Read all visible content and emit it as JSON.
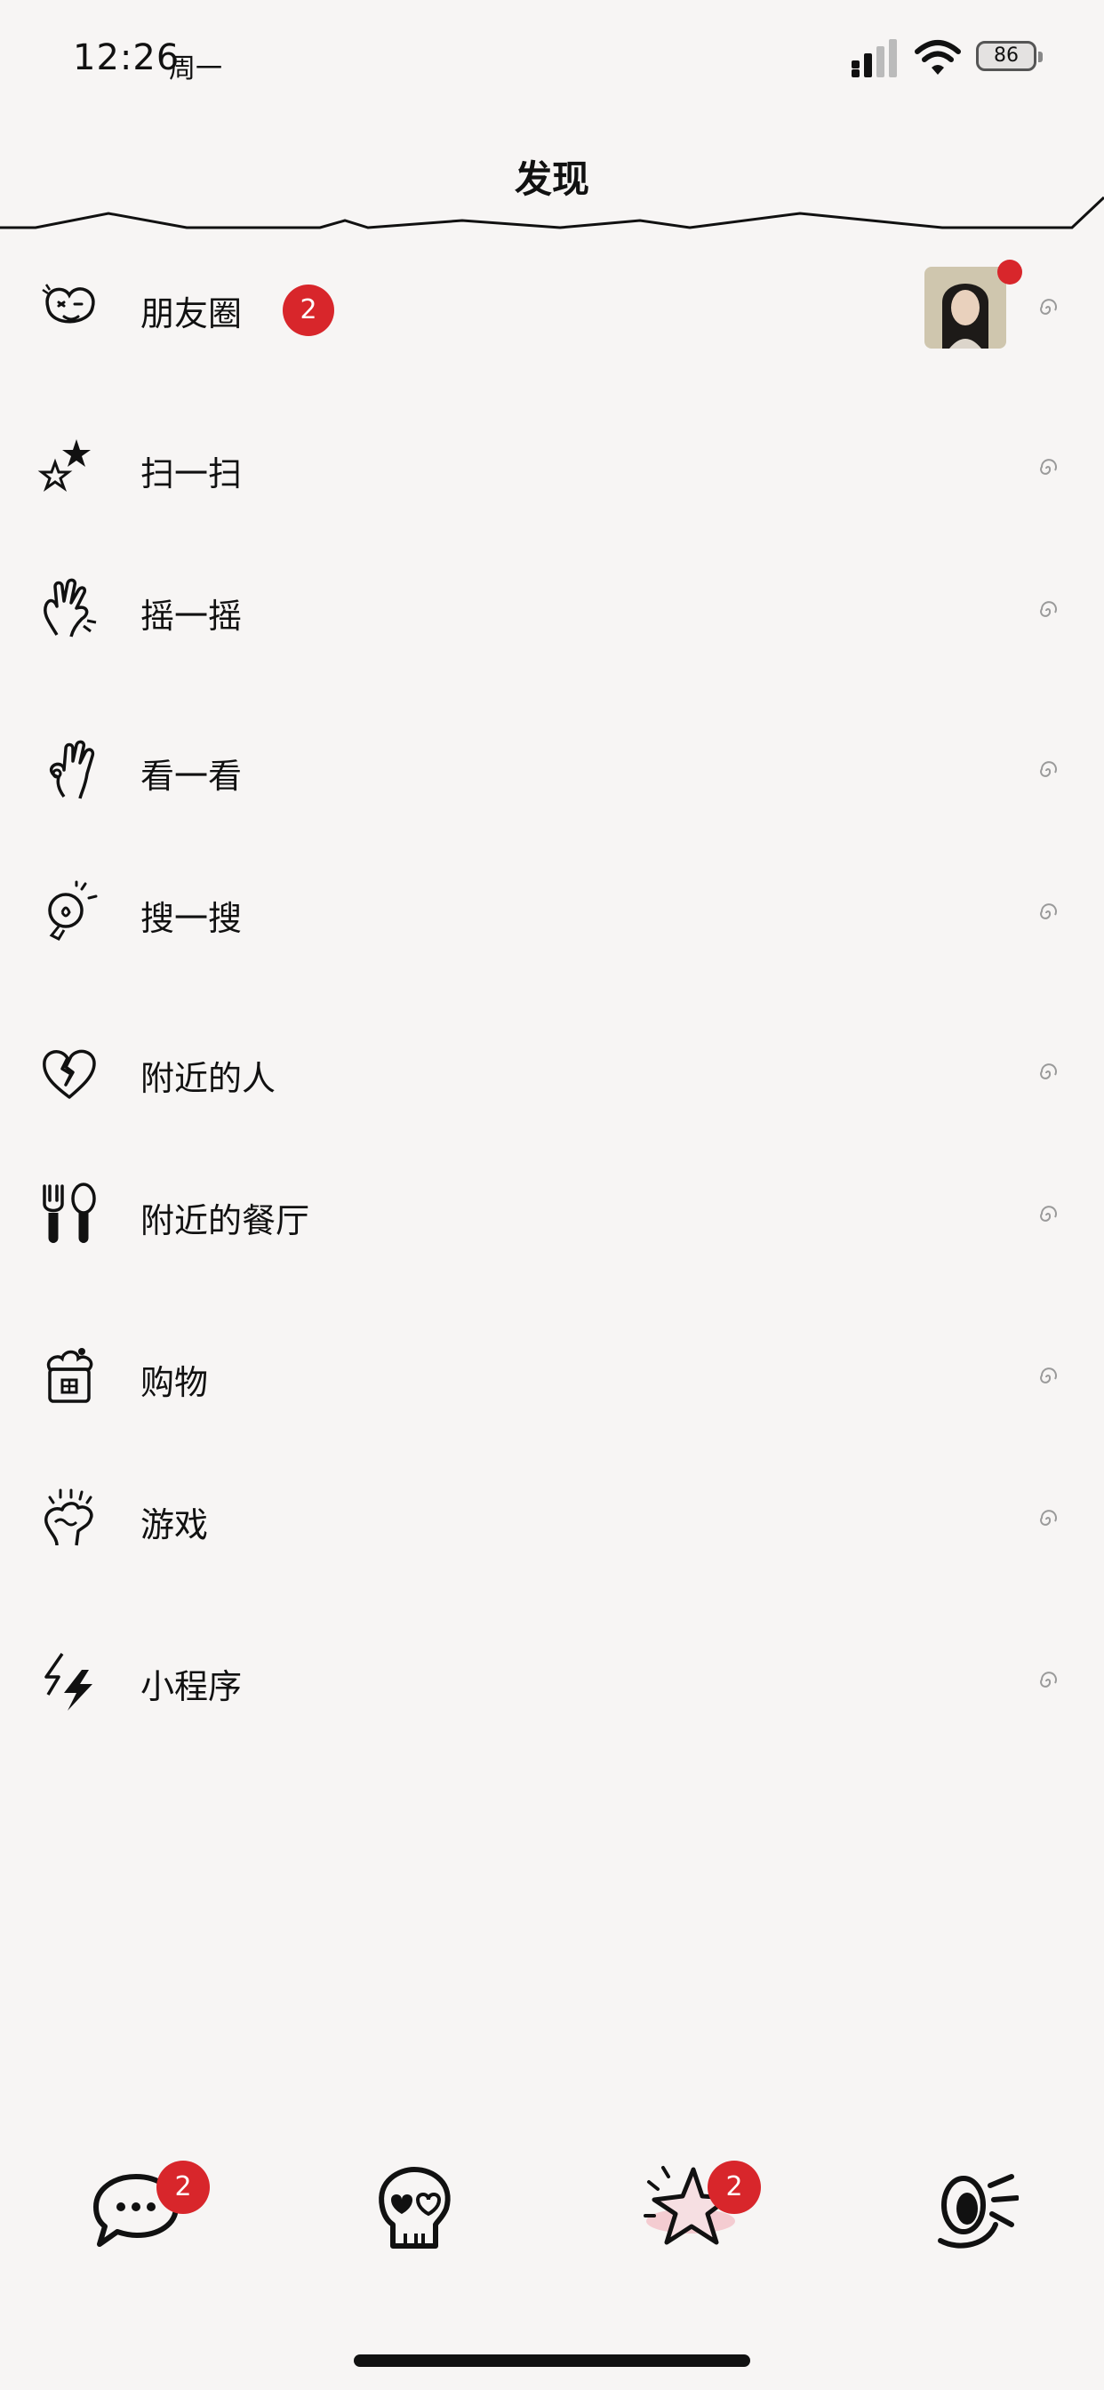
{
  "status_bar": {
    "time": "12:26",
    "day": "周一",
    "battery": "86"
  },
  "nav": {
    "title": "发现"
  },
  "menu": {
    "moments": {
      "label": "朋友圈",
      "badge": "2",
      "icon": "smirk-face-icon"
    },
    "scan": {
      "label": "扫一扫",
      "icon": "stars-icon"
    },
    "shake": {
      "label": "摇一摇",
      "icon": "shaking-hand-icon"
    },
    "look": {
      "label": "看一看",
      "icon": "ok-hand-icon"
    },
    "search": {
      "label": "搜一搜",
      "icon": "lightbulb-icon"
    },
    "nearby_people": {
      "label": "附近的人",
      "icon": "broken-heart-icon"
    },
    "nearby_restaurants": {
      "label": "附近的餐厅",
      "icon": "fork-spoon-icon"
    },
    "shopping": {
      "label": "购物",
      "icon": "cupcake-box-icon"
    },
    "games": {
      "label": "游戏",
      "icon": "excited-hand-icon"
    },
    "mini_programs": {
      "label": "小程序",
      "icon": "lightning-icon"
    }
  },
  "tab_bar": {
    "chats_badge": "2",
    "discover_badge": "2",
    "tabs": [
      "chat-bubble-icon",
      "skull-heart-icon",
      "star-icon",
      "winking-eye-icon"
    ]
  },
  "colors": {
    "background": "#f7f5f4",
    "badge": "#d8262b",
    "text": "#111111"
  }
}
